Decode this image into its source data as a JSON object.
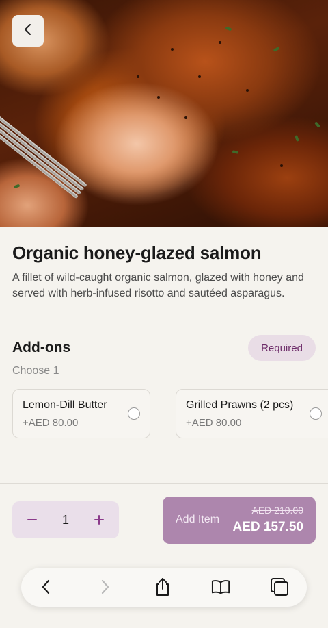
{
  "product": {
    "title": "Organic honey-glazed salmon",
    "description": "A fillet of wild-caught organic salmon, glazed with honey and served with herb-infused risotto and sautéed asparagus."
  },
  "addons": {
    "title": "Add-ons",
    "badge": "Required",
    "instruction": "Choose 1",
    "options": [
      {
        "name": "Lemon-Dill Butter",
        "price": "+AED 80.00",
        "selected": false
      },
      {
        "name": "Grilled Prawns (2 pcs)",
        "price": "+AED 80.00",
        "selected": false
      }
    ]
  },
  "cart": {
    "quantity": "1",
    "add_label": "Add Item",
    "old_price": "AED 210.00",
    "new_price": "AED 157.50"
  },
  "icons": {
    "back": "chevron-left-icon",
    "minus": "minus-icon",
    "plus": "plus-icon",
    "browser_back": "chevron-left-icon",
    "browser_forward": "chevron-right-icon",
    "share": "share-icon",
    "bookmarks": "book-icon",
    "tabs": "tabs-icon"
  },
  "colors": {
    "accent": "#8b3a8b",
    "button": "#ad86ad",
    "badge_bg": "#e9dde6",
    "stepper_bg": "#eadfea",
    "background": "#f5f3ee"
  }
}
